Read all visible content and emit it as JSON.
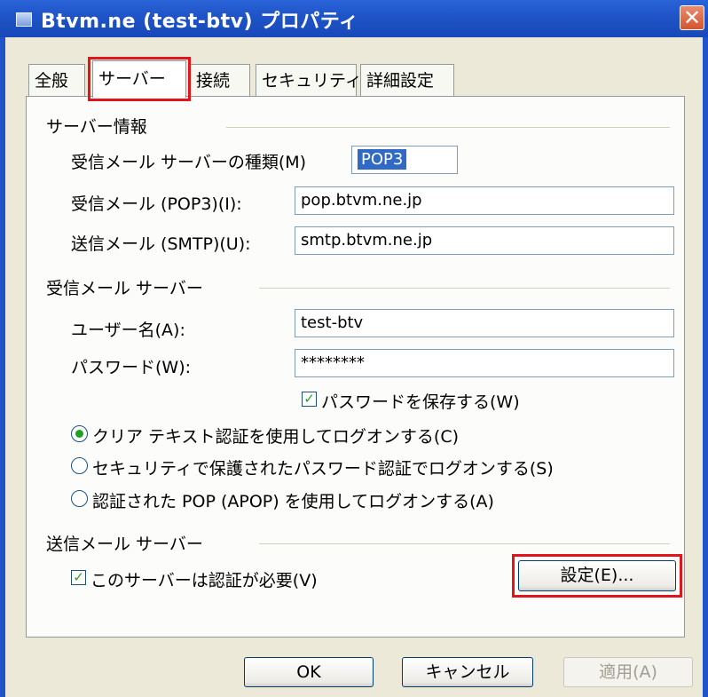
{
  "window": {
    "title": "Btvm.ne (test-btv) プロパティ",
    "close_glyph": "✕"
  },
  "tabs": [
    {
      "label": "全般"
    },
    {
      "label": "サーバー"
    },
    {
      "label": "接続"
    },
    {
      "label": "セキュリティ"
    },
    {
      "label": "詳細設定"
    }
  ],
  "server_info": {
    "group_label": "サーバー情報",
    "type_label": "受信メール サーバーの種類(M)",
    "type_value": "POP3",
    "incoming_label": "受信メール (POP3)(I):",
    "incoming_value": "pop.btvm.ne.jp",
    "outgoing_label": "送信メール (SMTP)(U):",
    "outgoing_value": "smtp.btvm.ne.jp"
  },
  "incoming_server": {
    "group_label": "受信メール サーバー",
    "username_label": "ユーザー名(A):",
    "username_value": "test-btv",
    "password_label": "パスワード(W):",
    "password_value": "********",
    "remember_label": "パスワードを保存する(W)",
    "remember_checked": true
  },
  "auth_options": [
    {
      "label": "クリア テキスト認証を使用してログオンする(C)",
      "checked": true
    },
    {
      "label": "セキュリティで保護されたパスワード認証でログオンする(S)",
      "checked": false
    },
    {
      "label": "認証された POP (APOP) を使用してログオンする(A)",
      "checked": false
    }
  ],
  "outgoing_server": {
    "group_label": "送信メール サーバー",
    "auth_required_label": "このサーバーは認証が必要(V)",
    "auth_required_checked": true,
    "settings_button": "設定(E)..."
  },
  "footer": {
    "ok": "OK",
    "cancel": "キャンセル",
    "apply": "適用(A)"
  },
  "colors": {
    "titlebar": "#1f55c8",
    "highlight": "#e0161c",
    "check": "#21a121"
  }
}
